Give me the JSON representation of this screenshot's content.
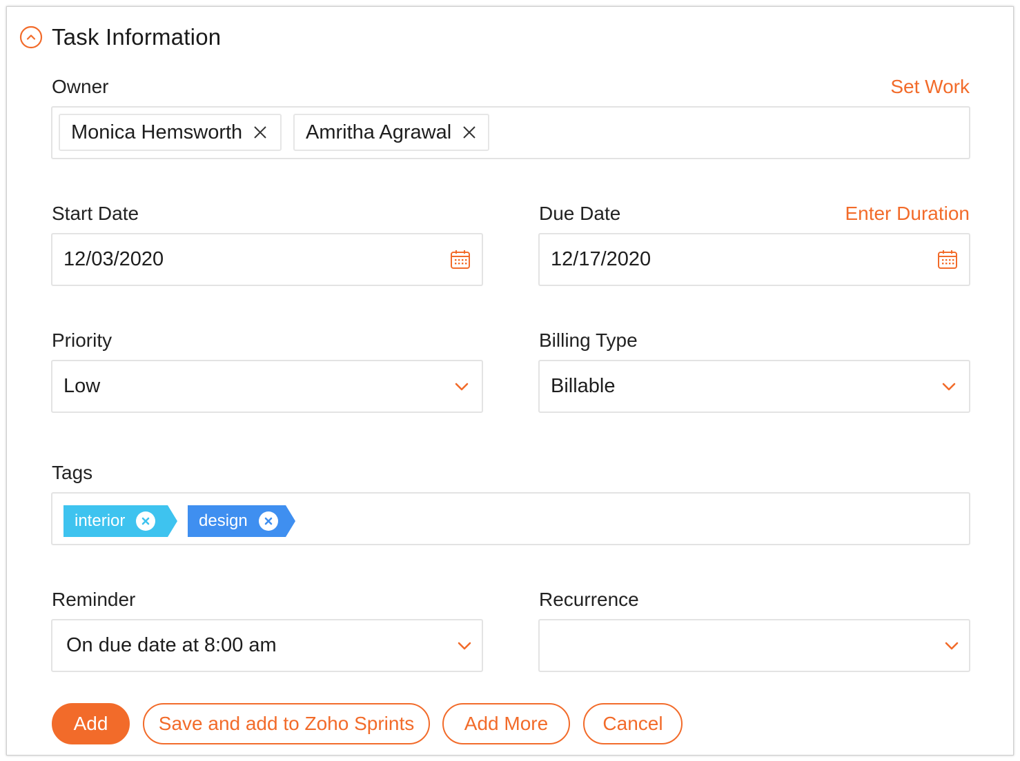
{
  "section": {
    "title": "Task Information",
    "collapse_icon": "chevron-up-circle-icon"
  },
  "owner": {
    "label": "Owner",
    "set_work_link": "Set Work",
    "chips": [
      "Monica Hemsworth",
      "Amritha Agrawal"
    ]
  },
  "start_date": {
    "label": "Start Date",
    "value": "12/03/2020",
    "icon": "calendar-icon"
  },
  "due_date": {
    "label": "Due Date",
    "value": "12/17/2020",
    "enter_duration_link": "Enter Duration",
    "icon": "calendar-icon"
  },
  "priority": {
    "label": "Priority",
    "value": "Low"
  },
  "billing_type": {
    "label": "Billing Type",
    "value": "Billable"
  },
  "tags": {
    "label": "Tags",
    "items": [
      {
        "text": "interior",
        "color": "#3ec3ef"
      },
      {
        "text": "design",
        "color": "#3f8ff0"
      }
    ]
  },
  "reminder": {
    "label": "Reminder",
    "value": "On due date at 8:00 am"
  },
  "recurrence": {
    "label": "Recurrence",
    "value": ""
  },
  "buttons": {
    "add": "Add",
    "save_sprints": "Save and add to Zoho Sprints",
    "add_more": "Add More",
    "cancel": "Cancel"
  },
  "colors": {
    "accent": "#f26b2a",
    "border": "#e3e3e3"
  }
}
